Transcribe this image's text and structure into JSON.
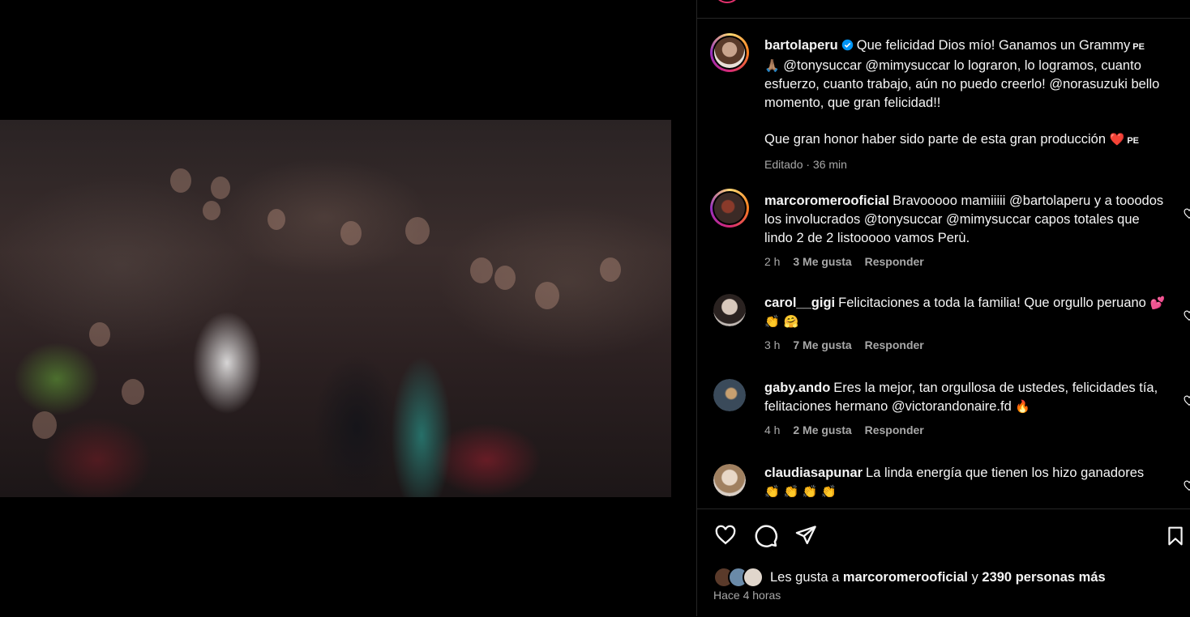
{
  "post": {
    "author": "bartolaperu",
    "caption_part1": "Que felicidad Dios mío! Ganamos un Grammy",
    "flag_1": "PE",
    "hands_emoji": "🙏🏽",
    "caption_part2": "@tonysuccar @mimysuccar lo lograron, lo logramos, cuanto esfuerzo, cuanto trabajo, aún no puedo creerlo! @norasuzuki bello momento, que gran felicidad!!",
    "caption_part3": "Que gran honor haber sido parte de esta gran producción",
    "heart_emoji": "❤️",
    "flag_2": "PE",
    "edited": "Editado · 36 min"
  },
  "comments": [
    {
      "user": "marcoromerooficial",
      "text": "Bravooooo mamiiiii @bartolaperu y a tooodos los involucrados @tonysuccar @mimysuccar capos totales que lindo 2 de 2 listooooo vamos Perù.",
      "time": "2 h",
      "likes": "3 Me gusta",
      "reply": "Responder",
      "avatar_color": "#3b2a26"
    },
    {
      "user": "carol__gigi",
      "text": "Felicitaciones a toda la familia! Que orgullo peruano",
      "emojis": "💕 👏 🤗",
      "time": "3 h",
      "likes": "7 Me gusta",
      "reply": "Responder",
      "avatar_color": "#bfb7b2"
    },
    {
      "user": "gaby.ando",
      "text": "Eres la mejor, tan orgullosa de ustedes, felicidades tía, felitaciones hermano @victorandonaire.fd",
      "emojis": "🔥",
      "time": "4 h",
      "likes": "2 Me gusta",
      "reply": "Responder",
      "avatar_color": "#3a4a5a"
    },
    {
      "user": "claudiasapunar",
      "text": "La linda energía que tienen los hizo ganadores",
      "emojis": "👏 👏 👏 👏",
      "avatar_color": "#d9cfc6"
    }
  ],
  "likes": {
    "prefix": "Les gusta a",
    "user": "marcoromerooficial",
    "connector": "y",
    "count": "2390 personas más",
    "time_ago": "Hace 4 horas"
  },
  "icons": {
    "like": "heart-icon",
    "comment": "comment-icon",
    "share": "send-icon",
    "save": "bookmark-icon",
    "volume": "volume-icon",
    "verified": "verified-badge-icon"
  },
  "colors": {
    "background": "#000000",
    "text": "#f5f5f5",
    "muted": "#a8a8a8",
    "verified": "#0095f6",
    "divider": "#262626"
  }
}
